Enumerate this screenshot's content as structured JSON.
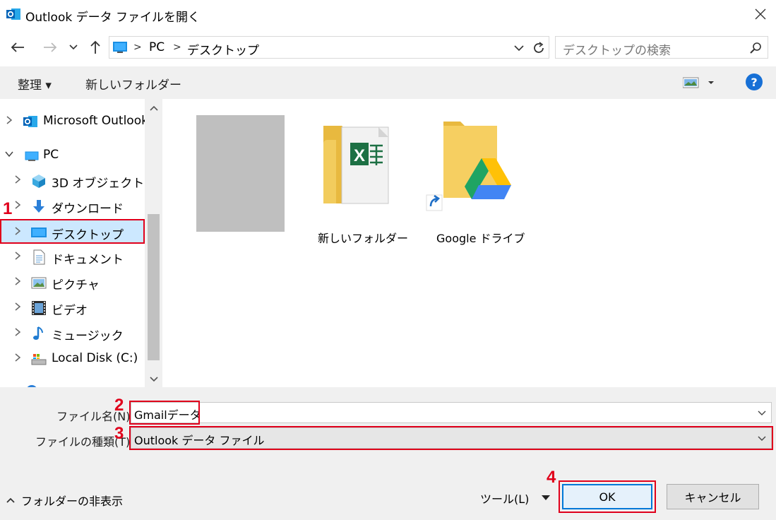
{
  "window": {
    "title": "Outlook データ ファイルを開く"
  },
  "address": {
    "segments": [
      "PC",
      "デスクトップ"
    ]
  },
  "search": {
    "placeholder": "デスクトップの検索"
  },
  "toolbar": {
    "organize": "整理 ▾",
    "new_folder": "新しいフォルダー",
    "help": "?"
  },
  "sidebar": {
    "items": [
      {
        "label": "Microsoft Outlook",
        "icon": "outlook-icon"
      },
      {
        "label": "PC",
        "icon": "pc-icon"
      },
      {
        "label": "3D オブジェクト",
        "icon": "3d-objects-icon"
      },
      {
        "label": "ダウンロード",
        "icon": "download-icon"
      },
      {
        "label": "デスクトップ",
        "icon": "desktop-icon"
      },
      {
        "label": "ドキュメント",
        "icon": "document-icon"
      },
      {
        "label": "ピクチャ",
        "icon": "pictures-icon"
      },
      {
        "label": "ビデオ",
        "icon": "video-icon"
      },
      {
        "label": "ミュージック",
        "icon": "music-icon"
      },
      {
        "label": "Local Disk (C:)",
        "icon": "disk-icon"
      }
    ]
  },
  "files": [
    {
      "label": "",
      "icon": "gray-thumbnail"
    },
    {
      "label": "新しいフォルダー",
      "icon": "folder-excel-icon"
    },
    {
      "label": "Google ドライブ",
      "icon": "folder-google-drive-icon"
    }
  ],
  "form": {
    "filename_label": "ファイル名(N):",
    "filename_value": "Gmailデータ",
    "filetype_label": "ファイルの種類(T):",
    "filetype_value": "Outlook データ ファイル"
  },
  "footer": {
    "hide_folders": "フォルダーの非表示",
    "tools": "ツール(L)",
    "ok": "OK",
    "cancel": "キャンセル"
  },
  "annotations": {
    "step1": "1",
    "step2": "2",
    "step3": "3",
    "step4": "4"
  },
  "colors": {
    "accent": "#0078d7",
    "selection": "#cce8ff",
    "annotation_red": "#e0001b",
    "panel": "#f0f0f0"
  }
}
